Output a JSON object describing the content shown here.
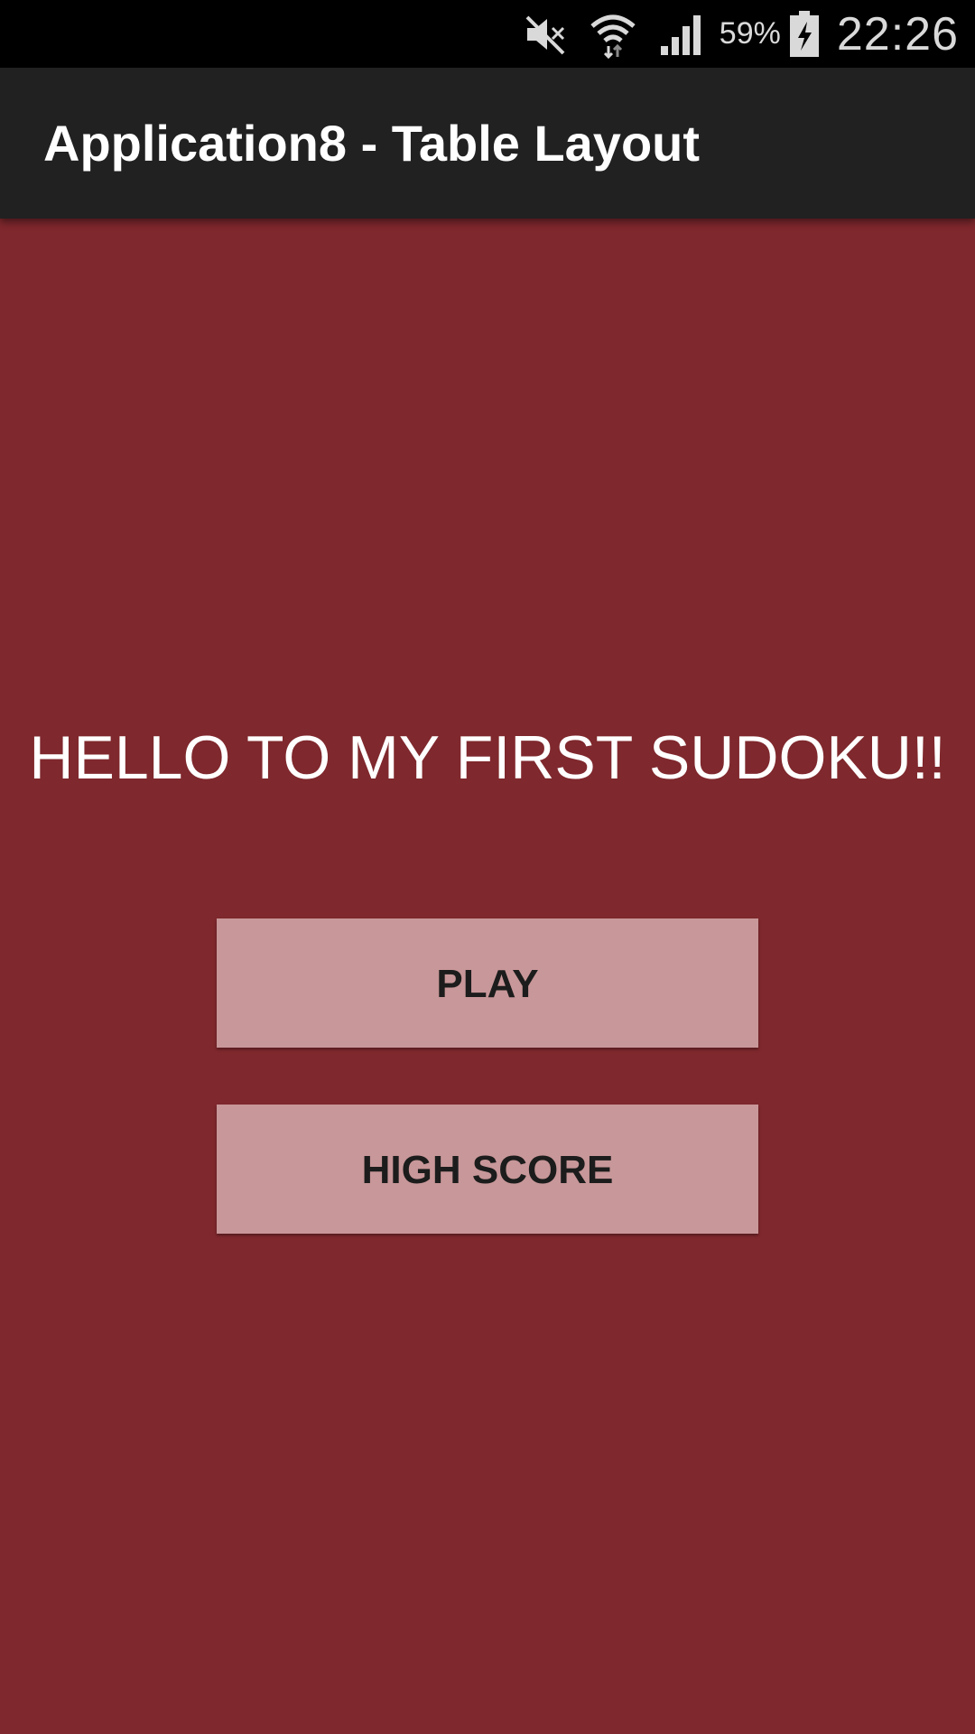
{
  "status_bar": {
    "icons": [
      "mute-icon",
      "wifi-icon",
      "cell-signal-icon",
      "battery-charging-icon"
    ],
    "battery_percent": "59%",
    "time": "22:26"
  },
  "app_bar": {
    "title": "Application8 - Table Layout"
  },
  "main": {
    "greeting": "HELLO TO MY FIRST SUDOKU!!",
    "buttons": {
      "play": "PLAY",
      "high_score": "HIGH SCORE"
    }
  },
  "colors": {
    "background": "#7f282d",
    "app_bar": "#212121",
    "status_bar": "#000000",
    "button": "#c89799"
  }
}
